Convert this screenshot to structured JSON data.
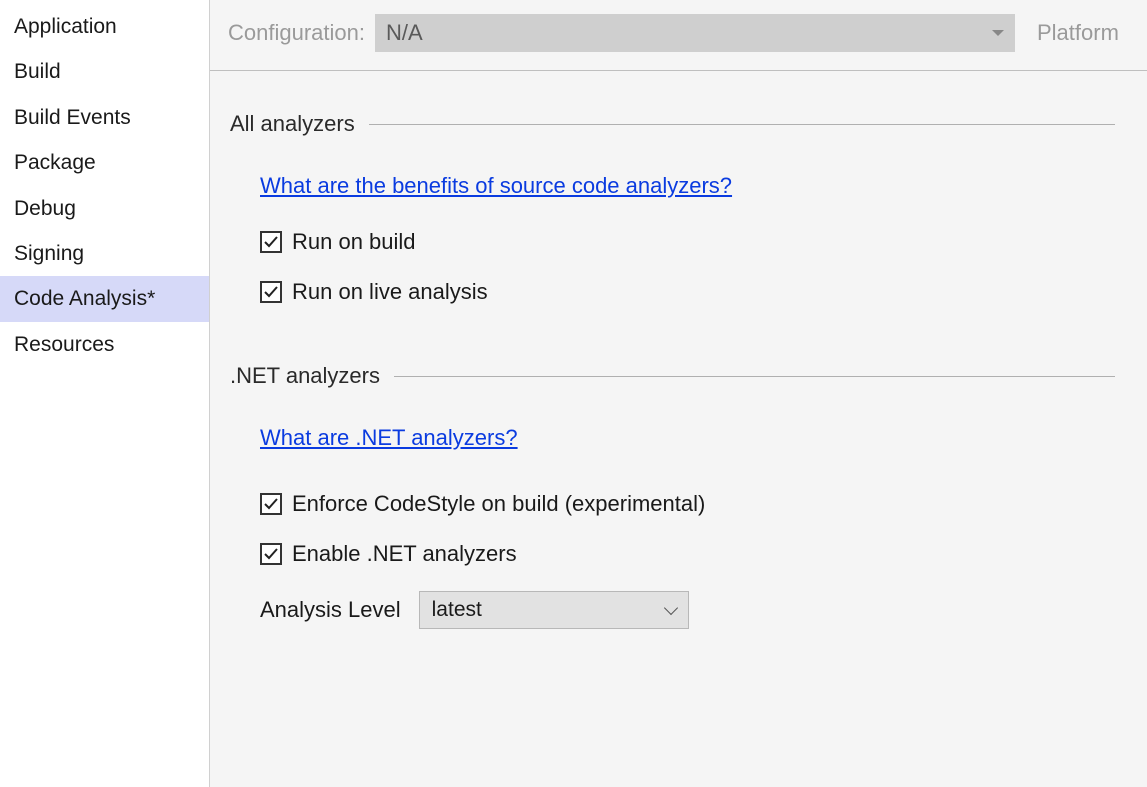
{
  "sidebar": {
    "items": [
      {
        "label": "Application"
      },
      {
        "label": "Build"
      },
      {
        "label": "Build Events"
      },
      {
        "label": "Package"
      },
      {
        "label": "Debug"
      },
      {
        "label": "Signing"
      },
      {
        "label": "Code Analysis*"
      },
      {
        "label": "Resources"
      }
    ],
    "selectedIndex": 6
  },
  "topBar": {
    "configurationLabel": "Configuration:",
    "configurationValue": "N/A",
    "platformLabel": "Platform"
  },
  "sections": {
    "allAnalyzers": {
      "title": "All analyzers",
      "link": "What are the benefits of source code analyzers?",
      "checkboxes": [
        {
          "label": "Run on build",
          "checked": true
        },
        {
          "label": "Run on live analysis",
          "checked": true
        }
      ]
    },
    "netAnalyzers": {
      "title": ".NET analyzers",
      "link": "What are .NET analyzers?",
      "checkboxes": [
        {
          "label": "Enforce CodeStyle on build (experimental)",
          "checked": true
        },
        {
          "label": "Enable .NET analyzers",
          "checked": true
        }
      ],
      "analysisLevelLabel": "Analysis Level",
      "analysisLevelValue": "latest"
    }
  }
}
